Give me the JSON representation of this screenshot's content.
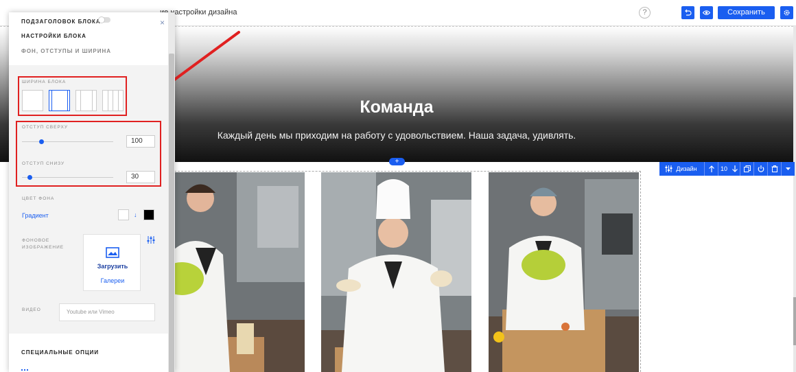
{
  "topbar": {
    "breadcrumb": "ие настройки дизайна",
    "help_icon_glyph": "?",
    "undo_icon": "undo-icon",
    "preview_icon": "eye-icon",
    "save_label": "Сохранить",
    "settings_icon": "gear-icon",
    "accent_color": "#1a5ef0"
  },
  "hero": {
    "title": "Команда",
    "subtitle": "Каждый день мы приходим на работу с удовольствием. Наша задача, удивлять.",
    "add_block_glyph": "+"
  },
  "design_toolbar": {
    "design_label": "Дизайн",
    "count": "10",
    "icons": [
      "sliders-icon",
      "arrow-up-icon",
      "arrow-down-icon",
      "duplicate-icon",
      "power-icon",
      "trash-icon",
      "caret-down-icon"
    ]
  },
  "panel": {
    "close_glyph": "×",
    "tab_subtitle": "ПОДЗАГОЛОВОК БЛОКА",
    "tab_settings": "НАСТРОЙКИ БЛОКА",
    "tab_background": "ФОН, ОТСТУПЫ И ШИРИНА",
    "width_label": "ШИРИНА БЛОКА",
    "width_options": [
      "full",
      "wide",
      "medium",
      "columns"
    ],
    "width_selected": "wide",
    "padding_top_label": "ОТСТУП СВЕРХУ",
    "padding_top_value": "100",
    "padding_top_level": 0.2,
    "padding_bottom_label": "ОТСТУП СНИЗУ",
    "padding_bottom_value": "30",
    "padding_bottom_level": 0.06,
    "bg_color_label": "ЦВЕТ ФОНА",
    "gradient_link": "Градиент",
    "gradient_from": "#ffffff",
    "gradient_to": "#000000",
    "gradient_arrow_glyph": "↓",
    "bg_image_label_1": "ФОНОВОЕ",
    "bg_image_label_2": "ИЗОБРАЖЕНИЕ",
    "upload_label": "Загрузить",
    "gallery_label": "Галереи",
    "video_label": "ВИДЕО",
    "video_placeholder": "Youtube или Vimeo",
    "special_options": "СПЕЦИАЛЬНЫЕ ОПЦИИ"
  }
}
